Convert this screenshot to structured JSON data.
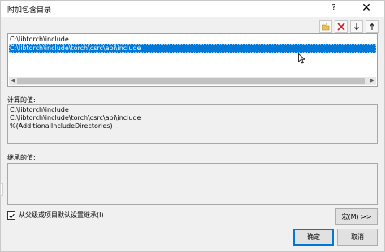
{
  "window": {
    "title": "附加包含目录",
    "help_glyph": "?",
    "close_glyph": "✕"
  },
  "toolbar": {
    "icons": [
      "new-folder-icon",
      "delete-icon",
      "move-down-icon",
      "move-up-icon"
    ],
    "move_down_glyph": "↓",
    "move_up_glyph": "↑"
  },
  "list": {
    "items": [
      {
        "text": "C:\\libtorch\\include",
        "selected": false
      },
      {
        "text": "C:\\libtorch\\include\\torch\\csrc\\api\\include",
        "selected": true
      }
    ]
  },
  "evaluated": {
    "label": "计算的值:",
    "lines": [
      "C:\\libtorch\\include",
      "C:\\libtorch\\include\\torch\\csrc\\api\\include",
      "%(AdditionalIncludeDirectories)"
    ]
  },
  "inherited": {
    "label": "继承的值:",
    "lines": []
  },
  "inherit_checkbox": {
    "label": "从父级或项目默认设置继承(I)",
    "checked": true
  },
  "buttons": {
    "macros": "宏(M) >>",
    "ok": "确定",
    "cancel": "取消"
  },
  "colors": {
    "selection": "#0078d7",
    "dialog_bg": "#f0f0f0",
    "delete_red": "#d62020"
  }
}
